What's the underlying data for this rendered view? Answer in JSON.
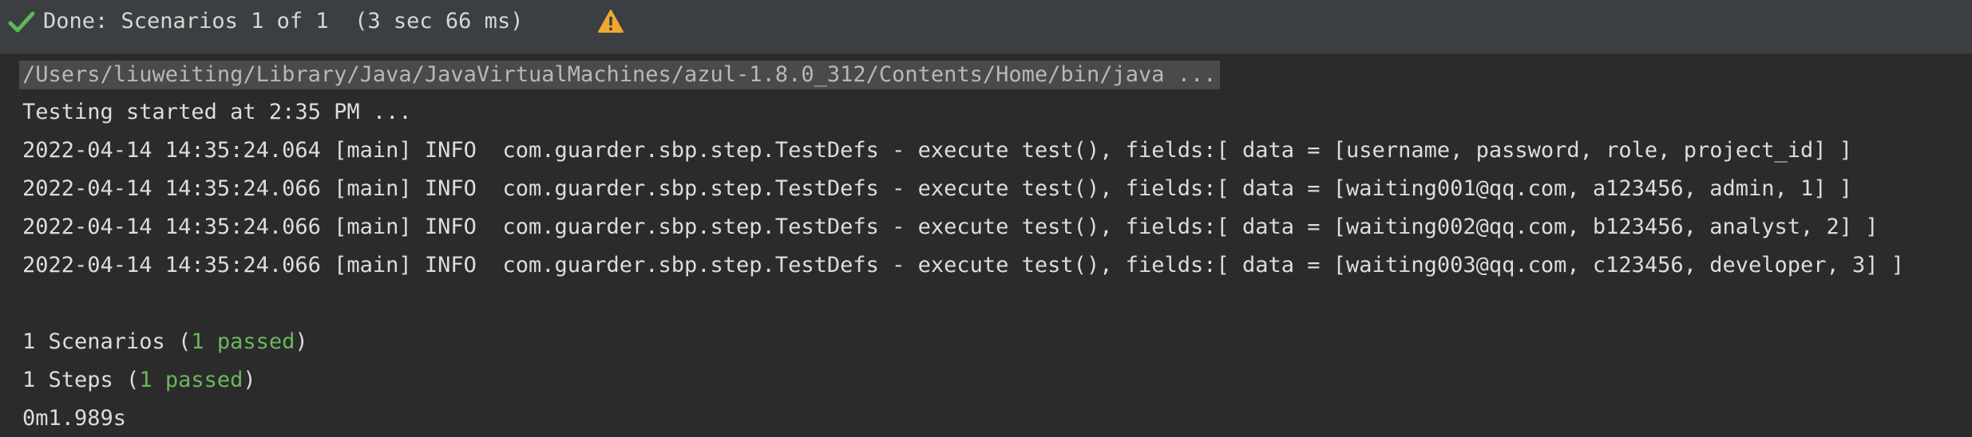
{
  "status": {
    "text": "Done: Scenarios 1 of 1  (3 sec 66 ms)",
    "icon_check": "checkmark-icon",
    "icon_warning": "warning-icon",
    "check_color": "#5fb85a",
    "warning_color": "#f0a732"
  },
  "console": {
    "command": "/Users/liuweiting/Library/Java/JavaVirtualMachines/azul-1.8.0_312/Contents/Home/bin/java ...",
    "started": "Testing started at 2:35 PM ...",
    "logs": [
      "2022-04-14 14:35:24.064 [main] INFO  com.guarder.sbp.step.TestDefs - execute test(), fields:[ data = [username, password, role, project_id] ]",
      "2022-04-14 14:35:24.066 [main] INFO  com.guarder.sbp.step.TestDefs - execute test(), fields:[ data = [waiting001@qq.com, a123456, admin, 1] ]",
      "2022-04-14 14:35:24.066 [main] INFO  com.guarder.sbp.step.TestDefs - execute test(), fields:[ data = [waiting002@qq.com, b123456, analyst, 2] ]",
      "2022-04-14 14:35:24.066 [main] INFO  com.guarder.sbp.step.TestDefs - execute test(), fields:[ data = [waiting003@qq.com, c123456, developer, 3] ]"
    ],
    "scenarios": {
      "prefix": "1 Scenarios (",
      "passed": "1 passed",
      "suffix": ")"
    },
    "steps": {
      "prefix": "1 Steps (",
      "passed": "1 passed",
      "suffix": ")"
    },
    "duration": "0m1.989s",
    "passed_color": "#6bb65c"
  }
}
